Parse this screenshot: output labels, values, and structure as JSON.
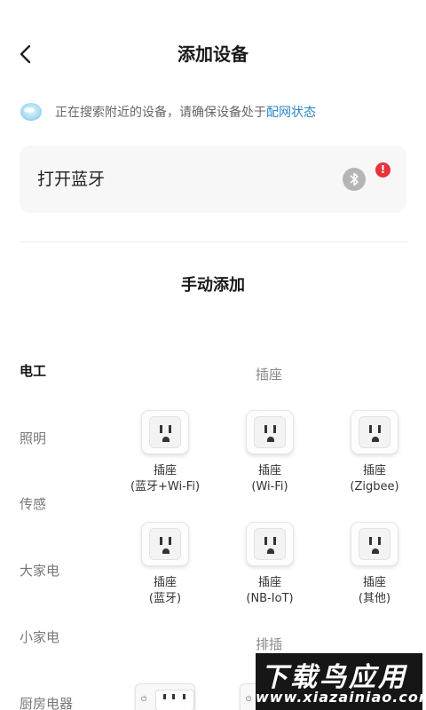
{
  "header": {
    "title": "添加设备",
    "back_icon": "chevron-left-icon"
  },
  "search": {
    "text": "正在搜索附近的设备，请确保设备处于",
    "link": "配网状态",
    "icon": "searching-cloud-icon"
  },
  "bluetooth": {
    "label": "打开蓝牙",
    "icon": "bluetooth-icon",
    "alert": "!"
  },
  "manual": {
    "title": "手动添加"
  },
  "categories": [
    {
      "label": "电工",
      "active": true
    },
    {
      "label": "照明",
      "active": false
    },
    {
      "label": "传感",
      "active": false
    },
    {
      "label": "大家电",
      "active": false
    },
    {
      "label": "小家电",
      "active": false
    },
    {
      "label": "厨房电器",
      "active": false
    }
  ],
  "groups": [
    {
      "title": "插座",
      "items": [
        {
          "name": "插座",
          "sub": "(蓝牙+Wi-Fi)",
          "icon": "outlet-icon"
        },
        {
          "name": "插座",
          "sub": "(Wi-Fi)",
          "icon": "outlet-icon"
        },
        {
          "name": "插座",
          "sub": "(Zigbee)",
          "icon": "outlet-icon"
        },
        {
          "name": "插座",
          "sub": "(蓝牙)",
          "icon": "outlet-icon"
        },
        {
          "name": "插座",
          "sub": "(NB-IoT)",
          "icon": "outlet-icon"
        },
        {
          "name": "插座",
          "sub": "(其他)",
          "icon": "outlet-icon"
        }
      ]
    },
    {
      "title": "排插",
      "items": [
        {
          "icon": "power-strip-icon"
        },
        {
          "icon": "power-strip-icon"
        }
      ]
    }
  ],
  "watermark": {
    "main": "下载鸟应用",
    "sub": "www.xiazainiao.com"
  },
  "colors": {
    "accent_link": "#2f86c9",
    "alert_red": "#e8333a",
    "card_bg": "#f7f7f7"
  }
}
